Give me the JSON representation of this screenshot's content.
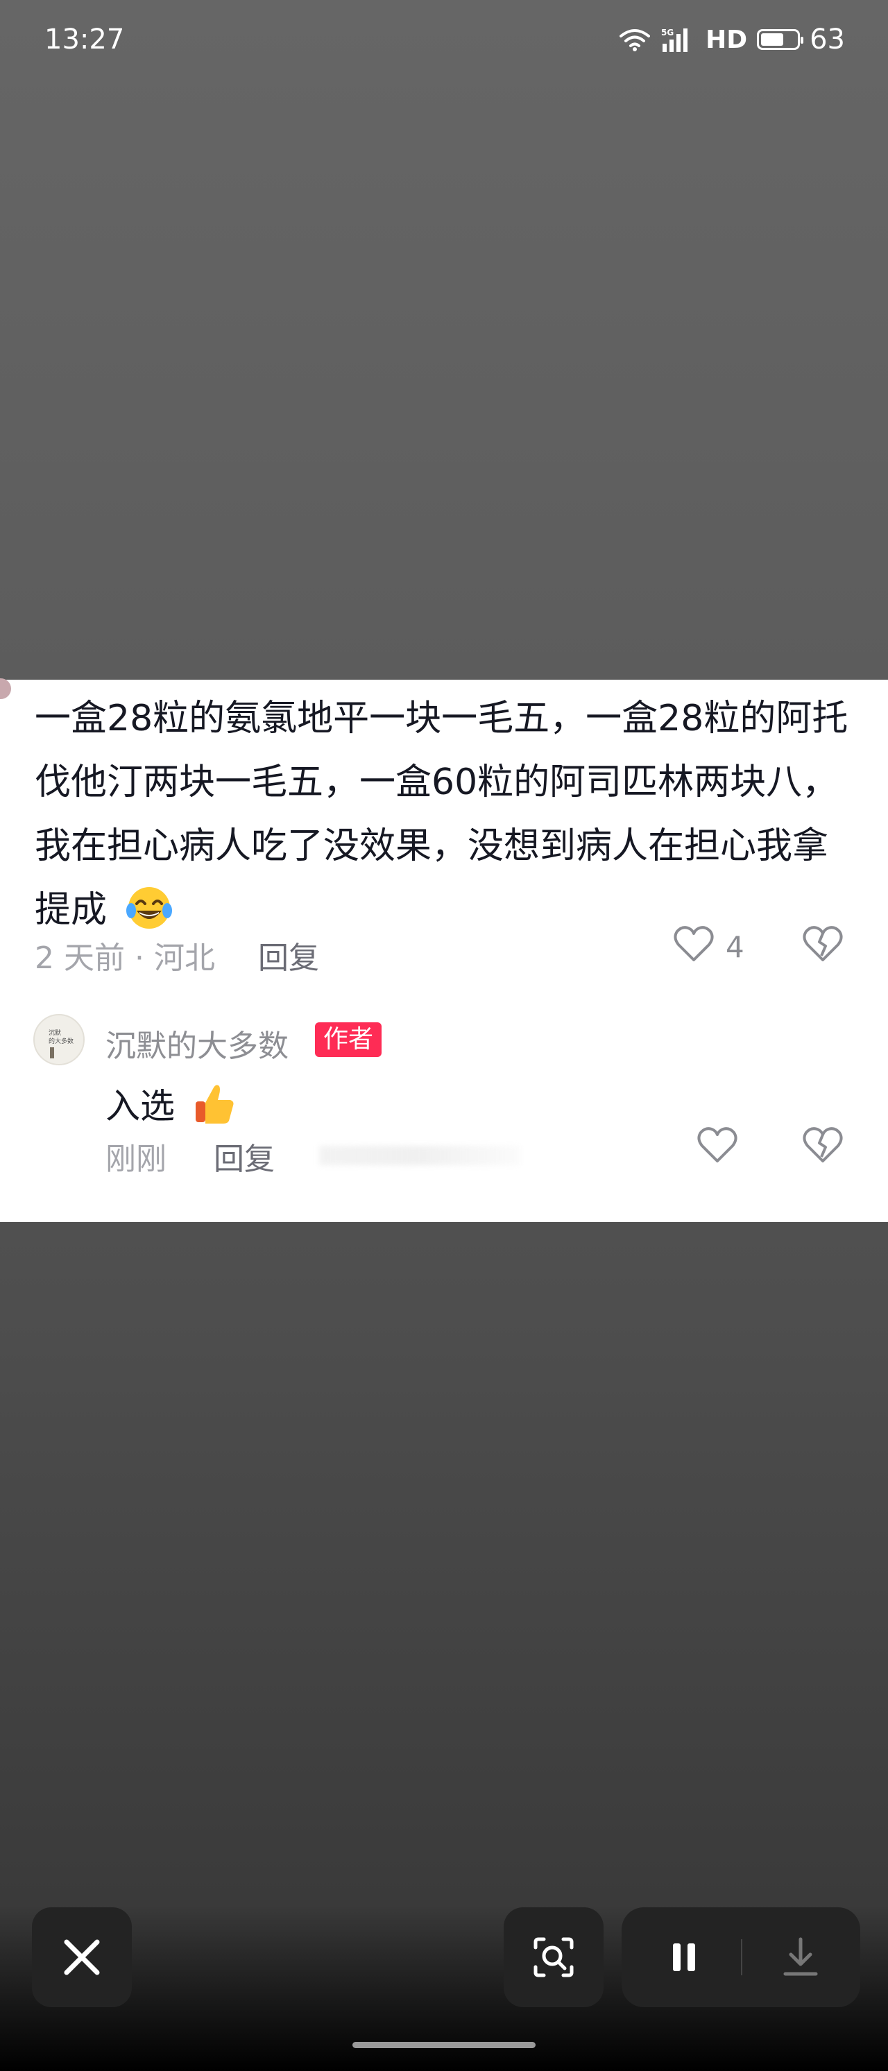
{
  "status_bar": {
    "time": "13:27",
    "network": "5G",
    "hd_label": "HD",
    "battery_level": "63",
    "battery_fraction": 0.63
  },
  "comment": {
    "text": "一盒28粒的氨氯地平一块一毛五，一盒28粒的阿托伐他汀两块一毛五，一盒60粒的阿司匹林两块八，我在担心病人吃了没效果，没想到病人在担心我拿提成",
    "emoji": "laughing-with-tears-icon",
    "meta": "2 天前 · 河北",
    "reply_label": "回复",
    "like_count": "4"
  },
  "reply": {
    "author": "沉默的大多数",
    "author_badge": "作者",
    "avatar_line1": "沉默",
    "avatar_line2": "的大多数",
    "text": "入选",
    "emoji": "thumbs-up-icon",
    "time": "刚刚",
    "reply_label": "回复"
  },
  "colors": {
    "badge": "#fe2c55",
    "card_bg": "#ffffff",
    "text_primary": "#161823",
    "text_secondary": "#a4a5ab"
  }
}
